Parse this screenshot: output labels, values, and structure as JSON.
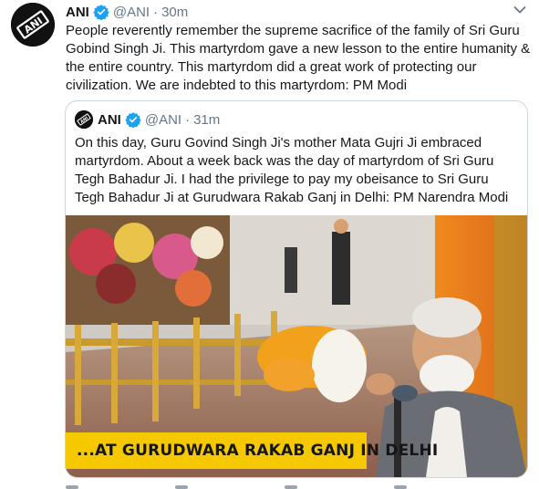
{
  "tweet": {
    "author_name": "ANI",
    "author_handle": "@ANI",
    "separator": "·",
    "time": "30m",
    "text": "People reverently remember the supreme sacrifice of the family of Sri Guru Gobind Singh Ji. This martyrdom gave a new lesson to the entire humanity & the entire country. This martyrdom did a great work of protecting our civilization. We are indebted to this martyrdom: PM Modi",
    "avatar_logo": "ANI",
    "more_icon": "chevron-down-icon"
  },
  "quoted_tweet": {
    "author_name": "ANI",
    "author_handle": "@ANI",
    "separator": "·",
    "time": "31m",
    "text": "On this day, Guru Govind Singh Ji's mother Mata Gujri Ji embraced martyrdom. About a week back was the day of martyrdom of Sri Guru Tegh Bahadur Ji. I had the privilege to pay my obeisance to Sri Guru Tegh Bahadur Ji at Gurudwara Rakab Ganj in Delhi: PM Narendra Modi",
    "media_caption": "...AT GURUDWARA RAKAB GANJ IN DELHI"
  },
  "colors": {
    "verified": "#1da1f2",
    "caption_bar": "#f5c800",
    "secondary_text": "#657786",
    "border": "#ccd6dd"
  }
}
